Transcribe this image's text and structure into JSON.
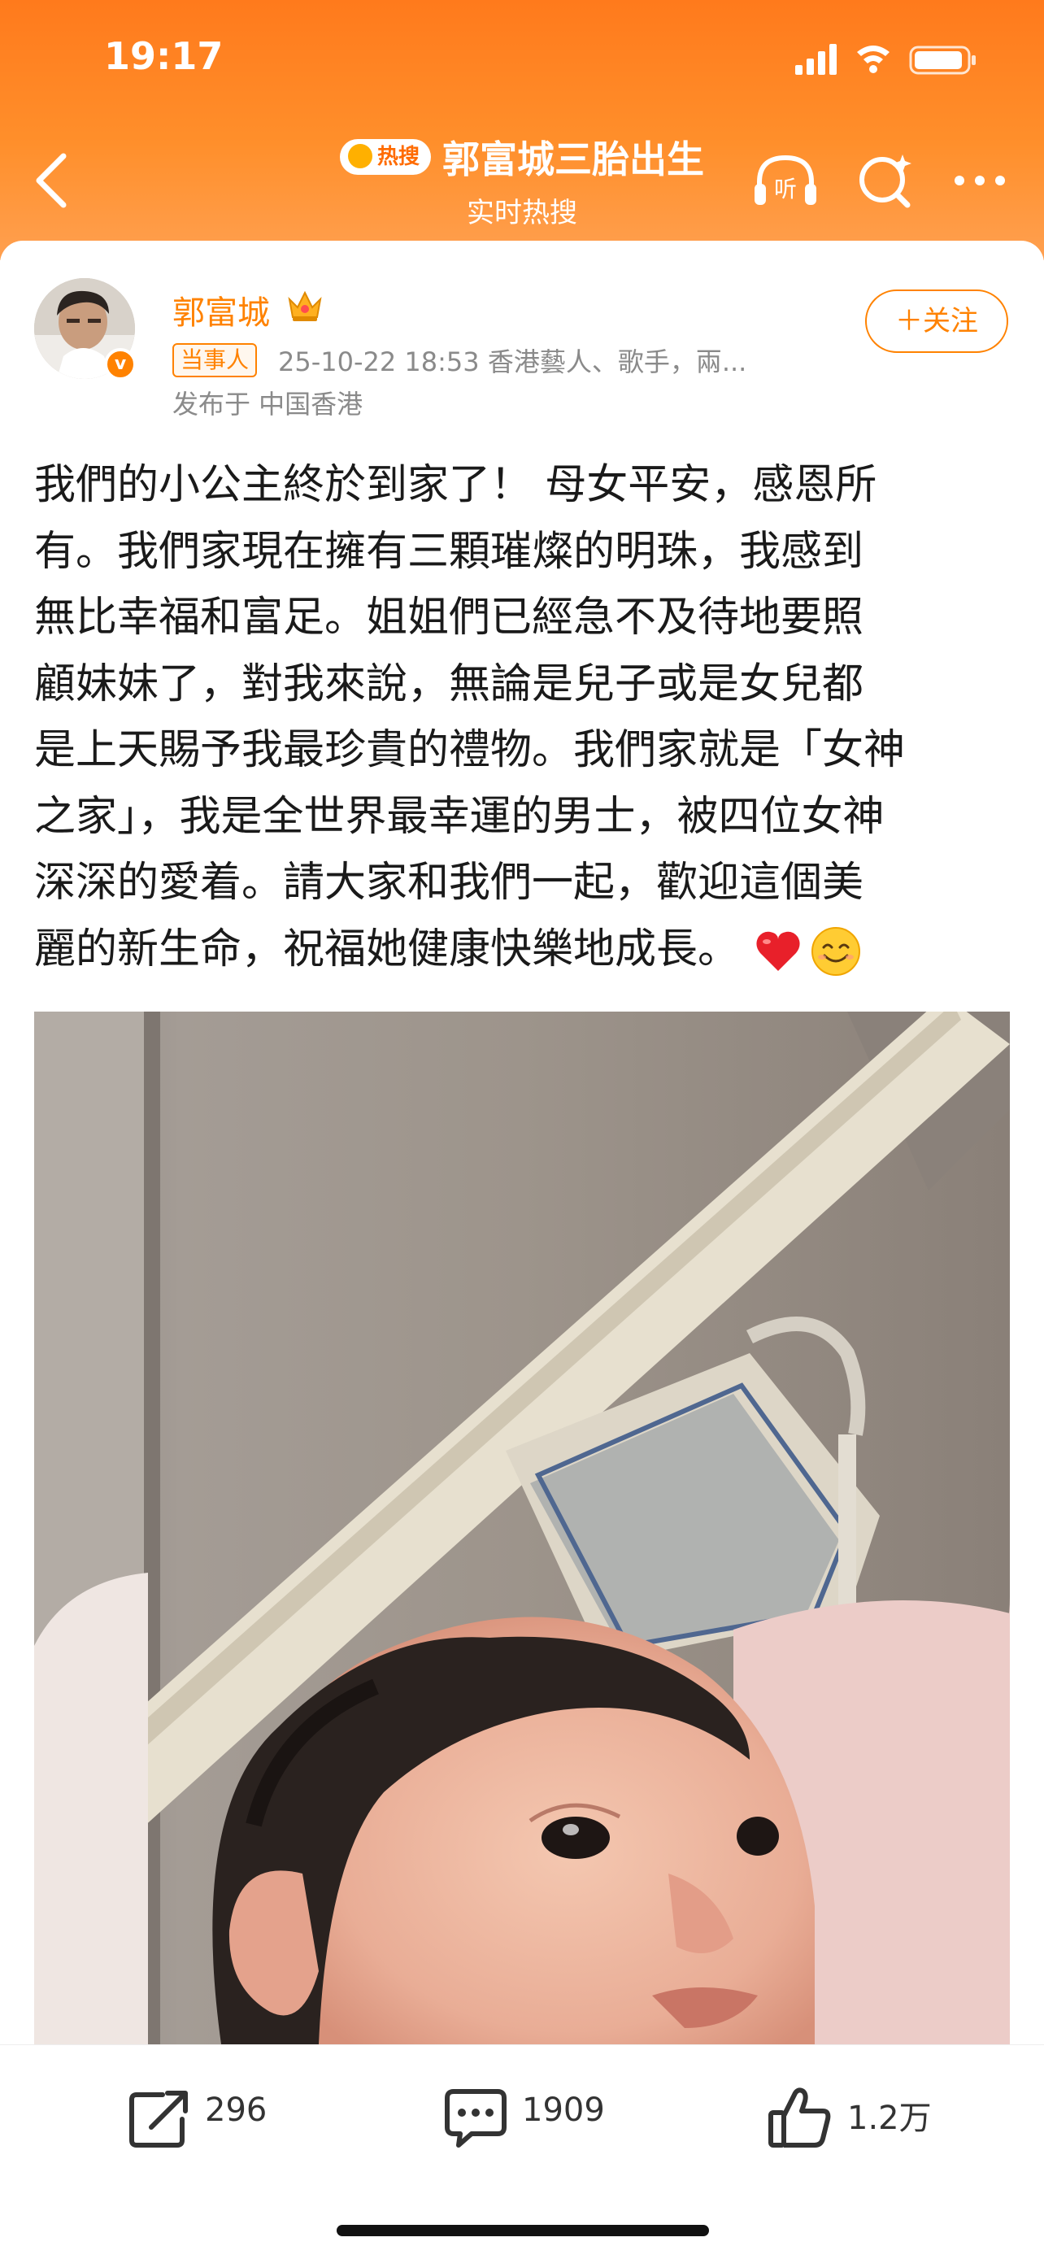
{
  "status_bar": {
    "time": "19:17"
  },
  "nav": {
    "hot_badge": "热搜",
    "title": "郭富城三胎出生",
    "subtitle": "实时热搜",
    "listen_label": "听"
  },
  "author": {
    "name": "郭富城",
    "role_badge": "当事人",
    "meta": "25-10-22 18:53  香港藝人、歌手，兩...",
    "location": "发布于 中国香港",
    "follow_label": "＋关注"
  },
  "post": {
    "lines": [
      "我們的小公主終於到家了！ 母女平安，感恩所",
      "有。我們家現在擁有三顆璀燦的明珠，我感到",
      "無比幸福和富足。姐姐們已經急不及待地要照",
      "顧妹妹了，對我來說，無論是兒子或是女兒都",
      "是上天賜予我最珍貴的禮物。我們家就是「女神",
      "之家」，我是全世界最幸運的男士，被四位女神",
      "深深的愛着。請大家和我們一起，歡迎這個美",
      "麗的新生命，祝福她健康快樂地成長。"
    ]
  },
  "actions": {
    "share_count": "296",
    "comment_count": "1909",
    "like_count": "1.2万"
  },
  "colors": {
    "accent": "#ff8200",
    "header_top": "#ff7a1c"
  }
}
